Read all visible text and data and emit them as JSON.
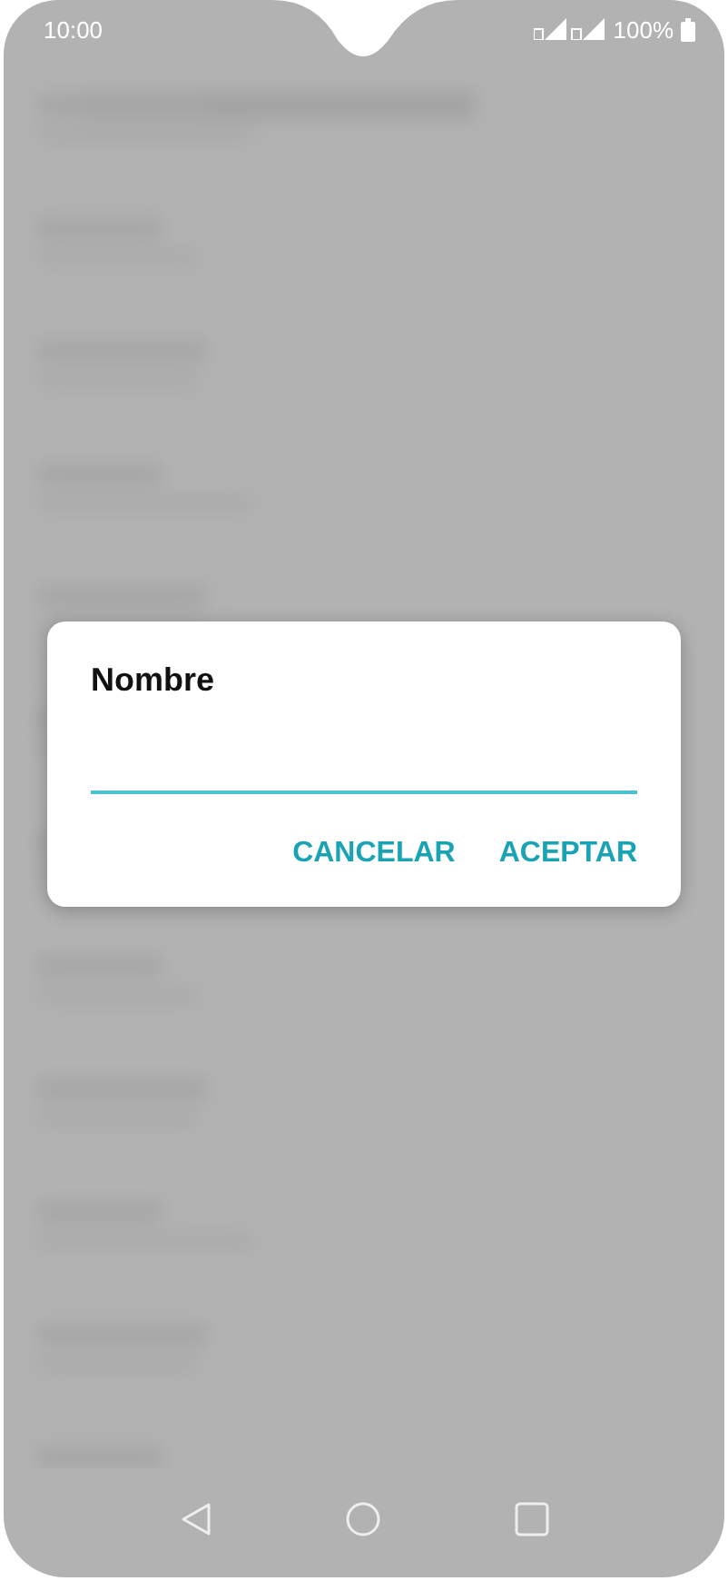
{
  "status_bar": {
    "time": "10:00",
    "battery": "100%"
  },
  "dialog": {
    "title": "Nombre",
    "field": {
      "focused": true
    },
    "buttons": [
      {
        "label": "CANCELAR"
      },
      {
        "label": "ACEPTAR"
      }
    ]
  }
}
